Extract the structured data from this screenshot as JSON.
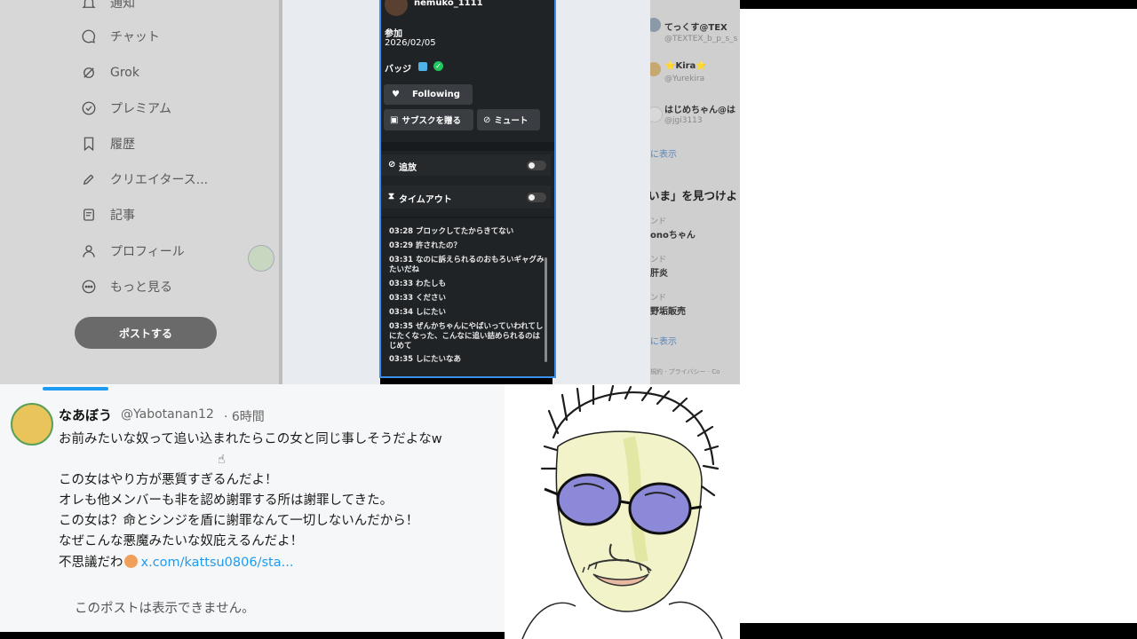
{
  "sidebar": {
    "items": [
      {
        "label": "通知",
        "icon": "bell-icon"
      },
      {
        "label": "チャット",
        "icon": "chat-icon"
      },
      {
        "label": "Grok",
        "icon": "grok-icon"
      },
      {
        "label": "プレミアム",
        "icon": "premium-icon"
      },
      {
        "label": "履歴",
        "icon": "bookmark-icon"
      },
      {
        "label": "クリエイタース...",
        "icon": "rocket-icon"
      },
      {
        "label": "記事",
        "icon": "article-icon"
      },
      {
        "label": "プロフィール",
        "icon": "person-icon"
      },
      {
        "label": "もっと見る",
        "icon": "more-icon"
      }
    ],
    "post_button": "ポストする"
  },
  "stream": {
    "username": "nemuko_1111",
    "joined_label": "参加",
    "joined_date": "2026/02/05",
    "badges_label": "バッジ",
    "following_label": "Following",
    "gift_sub_label": "サブスクを贈る",
    "mute_label": "ミュート",
    "ban_label": "追放",
    "timeout_label": "タイムアウト",
    "chat": [
      {
        "time": "03:28",
        "text": "ブロックしてたからきてない"
      },
      {
        "time": "03:29",
        "text": "許されたの？"
      },
      {
        "time": "03:31",
        "text": "なのに訴えられるのおもろいギャグみたいだね"
      },
      {
        "time": "03:33",
        "text": "わたしも"
      },
      {
        "time": "03:33",
        "text": "ください"
      },
      {
        "time": "03:34",
        "text": "しにたい"
      },
      {
        "time": "03:35",
        "text": "ぜんかちゃんにやばいっていわれてしにたくなった、こんなに追い詰められるのはじめて"
      },
      {
        "time": "03:35",
        "text": "しにたいなあ"
      }
    ]
  },
  "right_column": {
    "users": [
      {
        "name": "てっくす@TEX",
        "handle": "@TEXTEX_b_p_s_s"
      },
      {
        "name": "⭐Kira⭐",
        "handle": "@Yurekira"
      },
      {
        "name": "はじめちゃん@は",
        "handle": "@jgi3113"
      }
    ],
    "show_more": "に表示",
    "section_title": "いま」を見つけよ",
    "trends": [
      {
        "label": "ンド",
        "name": "onoちゃん"
      },
      {
        "label": "ンド",
        "name": "肝炎"
      },
      {
        "label": "ンド",
        "name": "野垢販売"
      }
    ],
    "show_more2": "に表示",
    "footer": "規約 · プライバシー · Co"
  },
  "tweet": {
    "display_name": "なあぼう",
    "handle": "@Yabotanan12",
    "time": "· 6時間",
    "lines": [
      "お前みたいな奴って追い込まれたらこの女と同じ事しそうだよなw",
      "この女はやり方が悪質すぎるんだよ！",
      "オレも他メンバーも非を認め謝罪する所は謝罪してきた。",
      "この女は？命とシンジを盾に謝罪なんて一切しないんだから！",
      "なぜこんな悪魔みたいな奴庇えるんだよ！",
      "不思議だわ"
    ],
    "link": "x.com/kattsu0806/sta...",
    "unavailable": "このポストは表示できません。"
  },
  "colors": {
    "accent": "#3b8eea",
    "link": "#1d9bf0",
    "verified": "#22c55e",
    "twitch": "#4fb3e8"
  }
}
